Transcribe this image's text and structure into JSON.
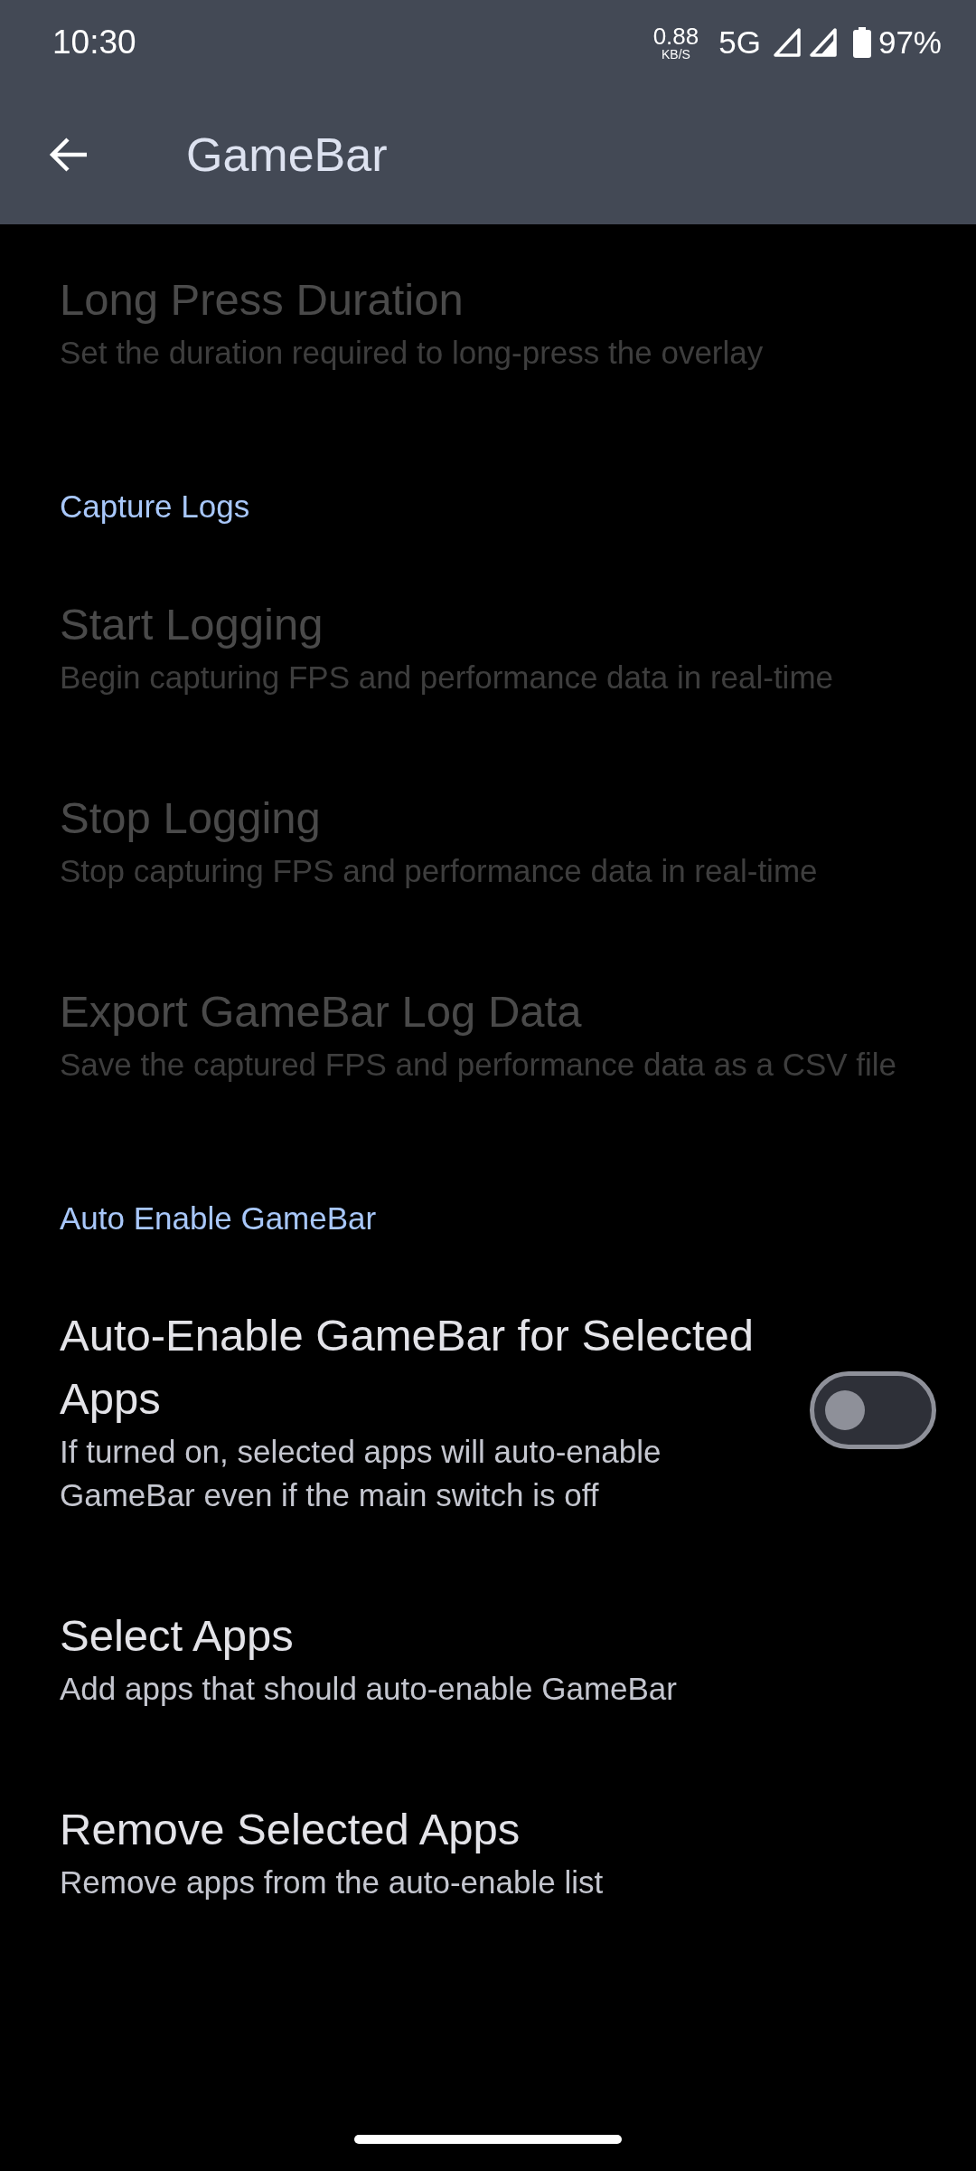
{
  "status_bar": {
    "time": "10:30",
    "speed": "0.88",
    "speed_unit": "KB/S",
    "network": "5G",
    "battery": "97%"
  },
  "app_bar": {
    "title": "GameBar"
  },
  "items": [
    {
      "kind": "preference",
      "title": "Long Press Duration",
      "summary": "Set the duration required to long-press the overlay",
      "disabled": true
    },
    {
      "kind": "header",
      "title": "Capture Logs"
    },
    {
      "kind": "preference",
      "title": "Start Logging",
      "summary": "Begin capturing FPS and performance data in real-time",
      "disabled": true
    },
    {
      "kind": "preference",
      "title": "Stop Logging",
      "summary": "Stop capturing FPS and performance data in real-time",
      "disabled": true
    },
    {
      "kind": "preference",
      "title": "Export GameBar Log Data",
      "summary": "Save the captured FPS and performance data as a CSV file",
      "disabled": true
    },
    {
      "kind": "header",
      "title": "Auto Enable GameBar"
    },
    {
      "kind": "switch",
      "title": "Auto-Enable GameBar for Selected Apps",
      "summary": "If turned on, selected apps will auto-enable GameBar even if the main switch is off",
      "disabled": false,
      "on": false
    },
    {
      "kind": "preference",
      "title": "Select Apps",
      "summary": "Add apps that should auto-enable GameBar",
      "disabled": false
    },
    {
      "kind": "preference",
      "title": "Remove Selected Apps",
      "summary": "Remove apps from the auto-enable list",
      "disabled": false
    }
  ]
}
